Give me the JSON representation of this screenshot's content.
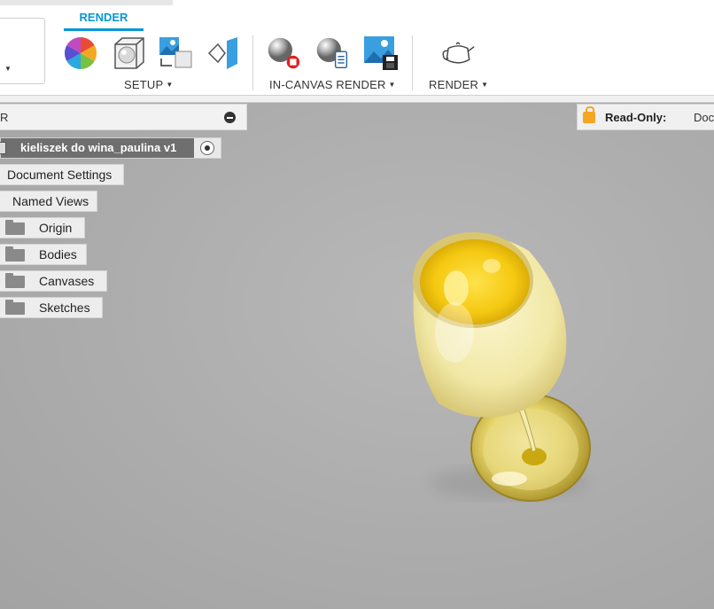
{
  "toolbar": {
    "workspace_label": "R",
    "active_tab": "RENDER",
    "groups": [
      {
        "label": "SETUP",
        "tools": [
          "scene-settings-icon",
          "appearance-icon",
          "environment-icon",
          "texture-map-icon"
        ]
      },
      {
        "label": "IN-CANVAS RENDER",
        "tools": [
          "in-canvas-render-icon",
          "in-canvas-settings-icon",
          "capture-image-icon"
        ]
      },
      {
        "label": "RENDER",
        "tools": [
          "render-teapot-icon"
        ]
      }
    ]
  },
  "browser": {
    "title": "R",
    "root": "kieliszek do wina_paulina v1",
    "items": [
      {
        "label": "Document Settings"
      },
      {
        "label": "Named Views"
      },
      {
        "label": "Origin"
      },
      {
        "label": "Bodies"
      },
      {
        "label": "Canvases"
      },
      {
        "label": "Sketches"
      }
    ]
  },
  "status": {
    "readonly_label": "Read-Only:",
    "readonly_value": "Doc"
  },
  "colors": {
    "accent": "#0696d7",
    "lock": "#f5a623",
    "viewport": "#aaaaaa"
  }
}
